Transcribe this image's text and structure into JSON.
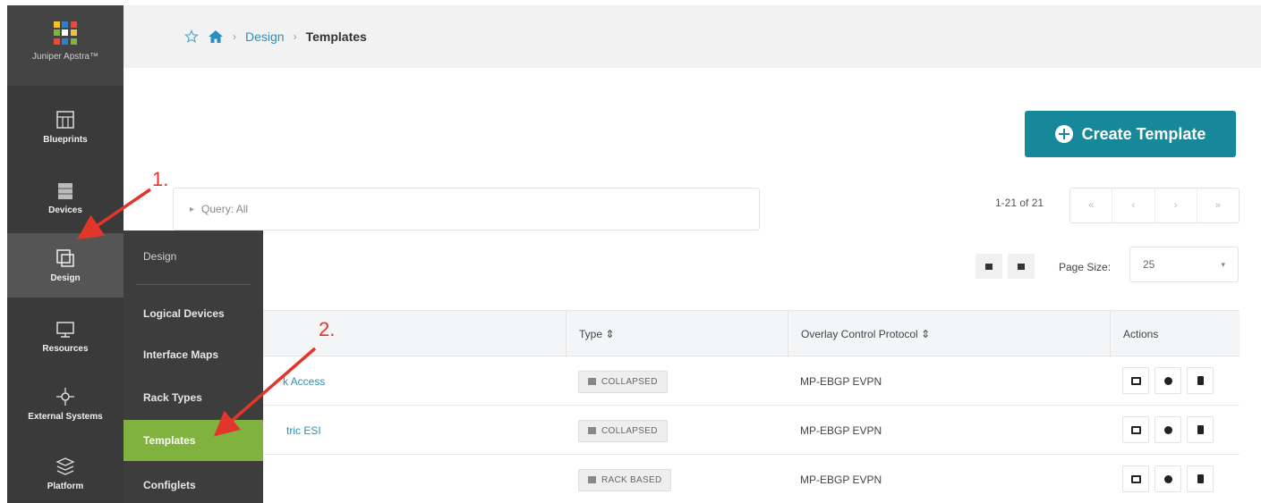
{
  "sidebar": {
    "logo_text": "Juniper Apstra™",
    "items": [
      {
        "label": "Blueprints",
        "icon": "blueprints-icon"
      },
      {
        "label": "Devices",
        "icon": "devices-icon"
      },
      {
        "label": "Design",
        "icon": "design-icon"
      },
      {
        "label": "Resources",
        "icon": "resources-icon"
      },
      {
        "label": "External Systems",
        "icon": "external-systems-icon"
      },
      {
        "label": "Platform",
        "icon": "platform-icon"
      }
    ],
    "active": "Design"
  },
  "flyout": {
    "header": "Design",
    "items": [
      "Logical Devices",
      "Interface Maps",
      "Rack Types",
      "Templates",
      "Configlets"
    ],
    "selected": "Templates"
  },
  "breadcrumb": {
    "link": "Design",
    "current": "Templates"
  },
  "toolbar": {
    "create_label": "Create Template"
  },
  "query": {
    "text": "Query: All"
  },
  "pagination": {
    "range": "1-21 of 21",
    "page_size_label": "Page Size:",
    "page_size_value": "25"
  },
  "table": {
    "headers": {
      "type": "Type ⇕",
      "protocol": "Overlay Control Protocol ⇕",
      "actions": "Actions"
    },
    "rows": [
      {
        "name": "k Access",
        "type": "COLLAPSED",
        "protocol": "MP-EBGP EVPN"
      },
      {
        "name": "tric ESI",
        "type": "COLLAPSED",
        "protocol": "MP-EBGP EVPN"
      },
      {
        "name": "",
        "type": "RACK BASED",
        "protocol": "MP-EBGP EVPN"
      }
    ]
  },
  "annotations": {
    "step1": "1.",
    "step2": "2."
  },
  "colors": {
    "sidebar_bg": "#3a3a3a",
    "accent_teal": "#16889a",
    "selected_green": "#7fb23f",
    "link_blue": "#2a8fbf",
    "annotation_red": "#e2362b"
  }
}
